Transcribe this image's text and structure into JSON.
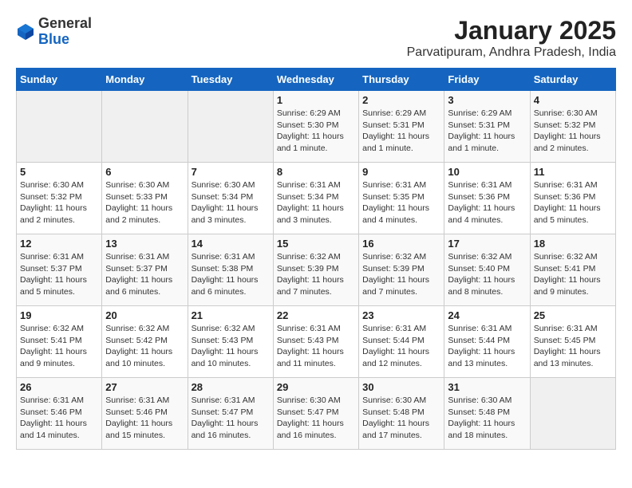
{
  "logo": {
    "general": "General",
    "blue": "Blue"
  },
  "title": "January 2025",
  "subtitle": "Parvatipuram, Andhra Pradesh, India",
  "weekdays": [
    "Sunday",
    "Monday",
    "Tuesday",
    "Wednesday",
    "Thursday",
    "Friday",
    "Saturday"
  ],
  "weeks": [
    [
      {
        "day": "",
        "info": ""
      },
      {
        "day": "",
        "info": ""
      },
      {
        "day": "",
        "info": ""
      },
      {
        "day": "1",
        "info": "Sunrise: 6:29 AM\nSunset: 5:30 PM\nDaylight: 11 hours and 1 minute."
      },
      {
        "day": "2",
        "info": "Sunrise: 6:29 AM\nSunset: 5:31 PM\nDaylight: 11 hours and 1 minute."
      },
      {
        "day": "3",
        "info": "Sunrise: 6:29 AM\nSunset: 5:31 PM\nDaylight: 11 hours and 1 minute."
      },
      {
        "day": "4",
        "info": "Sunrise: 6:30 AM\nSunset: 5:32 PM\nDaylight: 11 hours and 2 minutes."
      }
    ],
    [
      {
        "day": "5",
        "info": "Sunrise: 6:30 AM\nSunset: 5:32 PM\nDaylight: 11 hours and 2 minutes."
      },
      {
        "day": "6",
        "info": "Sunrise: 6:30 AM\nSunset: 5:33 PM\nDaylight: 11 hours and 2 minutes."
      },
      {
        "day": "7",
        "info": "Sunrise: 6:30 AM\nSunset: 5:34 PM\nDaylight: 11 hours and 3 minutes."
      },
      {
        "day": "8",
        "info": "Sunrise: 6:31 AM\nSunset: 5:34 PM\nDaylight: 11 hours and 3 minutes."
      },
      {
        "day": "9",
        "info": "Sunrise: 6:31 AM\nSunset: 5:35 PM\nDaylight: 11 hours and 4 minutes."
      },
      {
        "day": "10",
        "info": "Sunrise: 6:31 AM\nSunset: 5:36 PM\nDaylight: 11 hours and 4 minutes."
      },
      {
        "day": "11",
        "info": "Sunrise: 6:31 AM\nSunset: 5:36 PM\nDaylight: 11 hours and 5 minutes."
      }
    ],
    [
      {
        "day": "12",
        "info": "Sunrise: 6:31 AM\nSunset: 5:37 PM\nDaylight: 11 hours and 5 minutes."
      },
      {
        "day": "13",
        "info": "Sunrise: 6:31 AM\nSunset: 5:37 PM\nDaylight: 11 hours and 6 minutes."
      },
      {
        "day": "14",
        "info": "Sunrise: 6:31 AM\nSunset: 5:38 PM\nDaylight: 11 hours and 6 minutes."
      },
      {
        "day": "15",
        "info": "Sunrise: 6:32 AM\nSunset: 5:39 PM\nDaylight: 11 hours and 7 minutes."
      },
      {
        "day": "16",
        "info": "Sunrise: 6:32 AM\nSunset: 5:39 PM\nDaylight: 11 hours and 7 minutes."
      },
      {
        "day": "17",
        "info": "Sunrise: 6:32 AM\nSunset: 5:40 PM\nDaylight: 11 hours and 8 minutes."
      },
      {
        "day": "18",
        "info": "Sunrise: 6:32 AM\nSunset: 5:41 PM\nDaylight: 11 hours and 9 minutes."
      }
    ],
    [
      {
        "day": "19",
        "info": "Sunrise: 6:32 AM\nSunset: 5:41 PM\nDaylight: 11 hours and 9 minutes."
      },
      {
        "day": "20",
        "info": "Sunrise: 6:32 AM\nSunset: 5:42 PM\nDaylight: 11 hours and 10 minutes."
      },
      {
        "day": "21",
        "info": "Sunrise: 6:32 AM\nSunset: 5:43 PM\nDaylight: 11 hours and 10 minutes."
      },
      {
        "day": "22",
        "info": "Sunrise: 6:31 AM\nSunset: 5:43 PM\nDaylight: 11 hours and 11 minutes."
      },
      {
        "day": "23",
        "info": "Sunrise: 6:31 AM\nSunset: 5:44 PM\nDaylight: 11 hours and 12 minutes."
      },
      {
        "day": "24",
        "info": "Sunrise: 6:31 AM\nSunset: 5:44 PM\nDaylight: 11 hours and 13 minutes."
      },
      {
        "day": "25",
        "info": "Sunrise: 6:31 AM\nSunset: 5:45 PM\nDaylight: 11 hours and 13 minutes."
      }
    ],
    [
      {
        "day": "26",
        "info": "Sunrise: 6:31 AM\nSunset: 5:46 PM\nDaylight: 11 hours and 14 minutes."
      },
      {
        "day": "27",
        "info": "Sunrise: 6:31 AM\nSunset: 5:46 PM\nDaylight: 11 hours and 15 minutes."
      },
      {
        "day": "28",
        "info": "Sunrise: 6:31 AM\nSunset: 5:47 PM\nDaylight: 11 hours and 16 minutes."
      },
      {
        "day": "29",
        "info": "Sunrise: 6:30 AM\nSunset: 5:47 PM\nDaylight: 11 hours and 16 minutes."
      },
      {
        "day": "30",
        "info": "Sunrise: 6:30 AM\nSunset: 5:48 PM\nDaylight: 11 hours and 17 minutes."
      },
      {
        "day": "31",
        "info": "Sunrise: 6:30 AM\nSunset: 5:48 PM\nDaylight: 11 hours and 18 minutes."
      },
      {
        "day": "",
        "info": ""
      }
    ]
  ]
}
